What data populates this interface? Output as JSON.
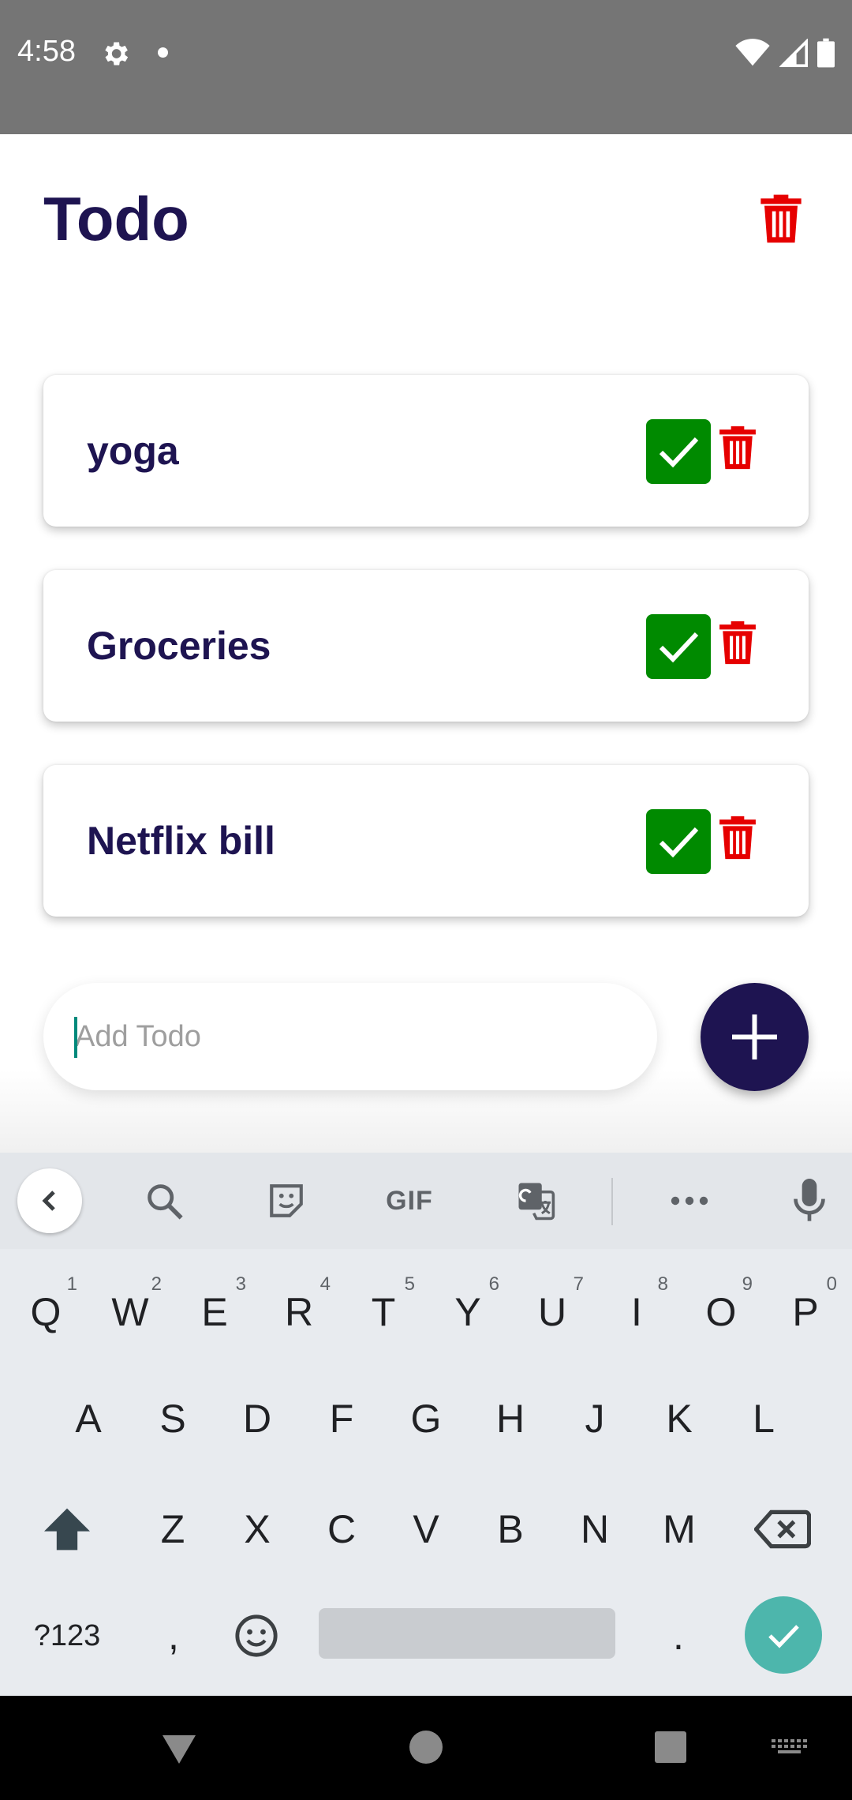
{
  "status_bar": {
    "time": "4:58",
    "icons": [
      "gear-icon",
      "notification-dot-icon",
      "wifi-icon",
      "signal-icon",
      "battery-icon"
    ]
  },
  "app": {
    "title": "Todo",
    "todos": [
      {
        "text": "yoga"
      },
      {
        "text": "Groceries"
      },
      {
        "text": "Netflix bill"
      }
    ],
    "input": {
      "value": "",
      "placeholder": "Add Todo"
    },
    "colors": {
      "primary": "#1e1451",
      "check": "#008a00",
      "delete": "#e60000"
    }
  },
  "keyboard": {
    "toolbar": [
      "back-icon",
      "search-icon",
      "sticker-icon",
      "GIF",
      "translate-icon",
      "more-icon",
      "mic-icon"
    ],
    "row1": [
      {
        "key": "Q",
        "hint": "1"
      },
      {
        "key": "W",
        "hint": "2"
      },
      {
        "key": "E",
        "hint": "3"
      },
      {
        "key": "R",
        "hint": "4"
      },
      {
        "key": "T",
        "hint": "5"
      },
      {
        "key": "Y",
        "hint": "6"
      },
      {
        "key": "U",
        "hint": "7"
      },
      {
        "key": "I",
        "hint": "8"
      },
      {
        "key": "O",
        "hint": "9"
      },
      {
        "key": "P",
        "hint": "0"
      }
    ],
    "row2": [
      "A",
      "S",
      "D",
      "F",
      "G",
      "H",
      "J",
      "K",
      "L"
    ],
    "row3": [
      "Z",
      "X",
      "C",
      "V",
      "B",
      "N",
      "M"
    ],
    "symbols_label": "?123",
    "comma": ",",
    "period": "."
  }
}
